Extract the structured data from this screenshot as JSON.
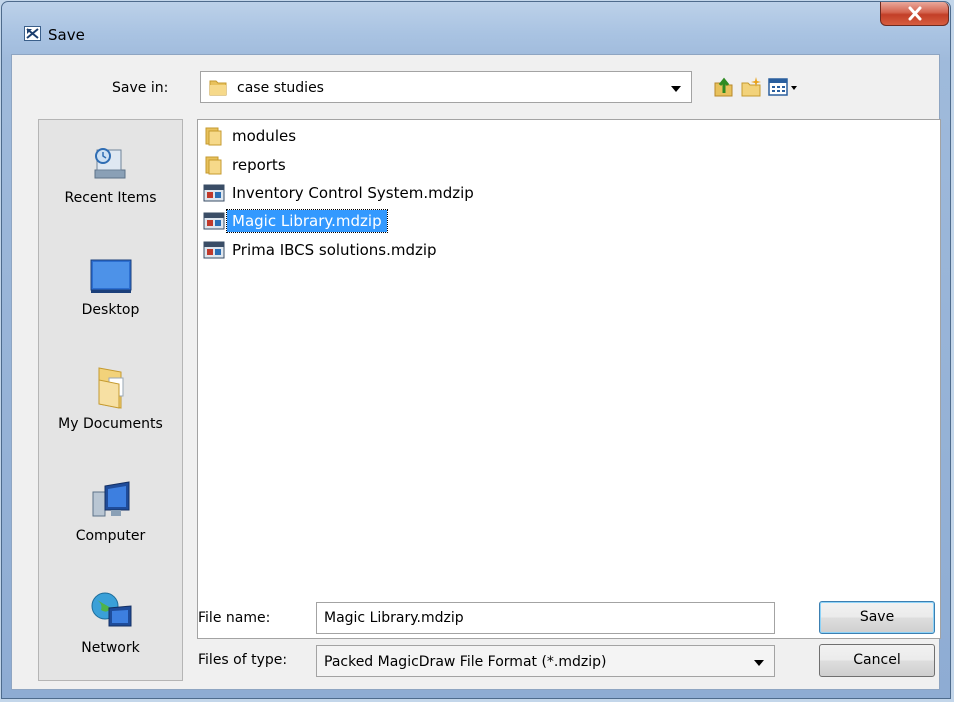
{
  "window": {
    "title": "Save",
    "close_label": "✕"
  },
  "save_in": {
    "label": "Save in:",
    "value": "case studies"
  },
  "toolbar": {
    "up_icon": "up-folder-icon",
    "new_folder_icon": "new-folder-icon",
    "view_menu_icon": "view-menu-icon"
  },
  "places": [
    {
      "label": "Recent Items",
      "icon": "recent-items-icon"
    },
    {
      "label": "Desktop",
      "icon": "desktop-icon"
    },
    {
      "label": "My Documents",
      "icon": "my-documents-icon"
    },
    {
      "label": "Computer",
      "icon": "computer-icon"
    },
    {
      "label": "Network",
      "icon": "network-icon"
    }
  ],
  "files": [
    {
      "name": "modules",
      "type": "folder"
    },
    {
      "name": "reports",
      "type": "folder"
    },
    {
      "name": "Inventory Control System.mdzip",
      "type": "mdzip"
    },
    {
      "name": "Magic Library.mdzip",
      "type": "mdzip",
      "selected": true
    },
    {
      "name": "Prima IBCS solutions.mdzip",
      "type": "mdzip"
    }
  ],
  "file_name": {
    "label": "File name:",
    "value": "Magic Library.mdzip"
  },
  "file_type": {
    "label": "Files of type:",
    "value": "Packed MagicDraw File Format (*.mdzip)"
  },
  "buttons": {
    "save": "Save",
    "cancel": "Cancel"
  },
  "colors": {
    "selection": "#3399ff",
    "close_button": "#c23f28",
    "title_bar": "#a9c3e2"
  }
}
